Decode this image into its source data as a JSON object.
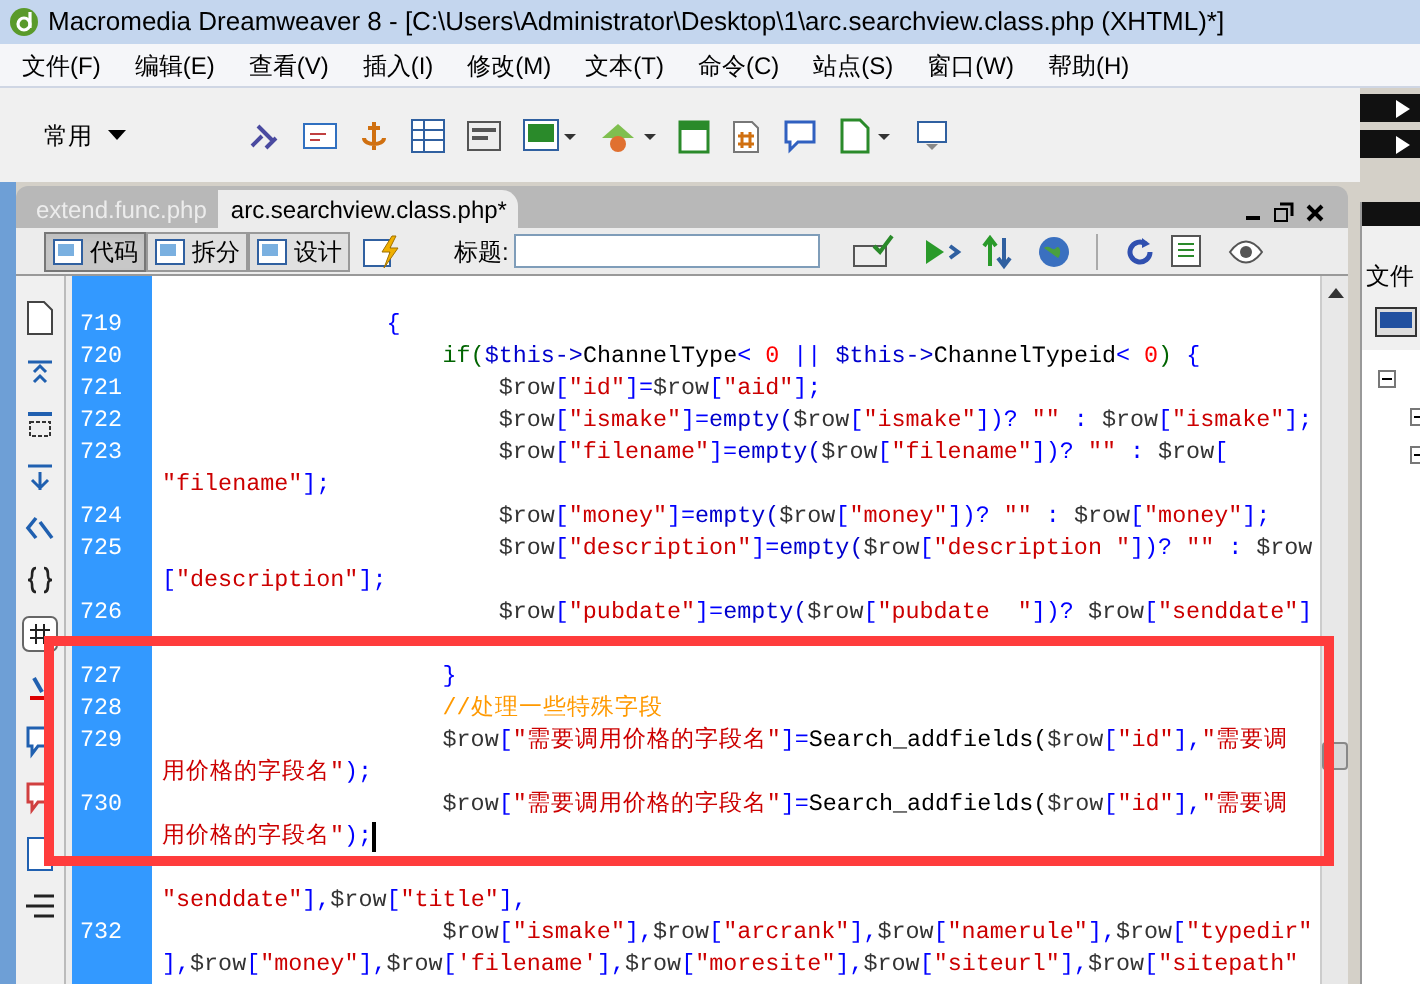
{
  "window": {
    "title": "Macromedia Dreamweaver 8 - [C:\\Users\\Administrator\\Desktop\\1\\arc.searchview.class.php (XHTML)*]"
  },
  "menu": [
    "文件(F)",
    "编辑(E)",
    "查看(V)",
    "插入(I)",
    "修改(M)",
    "文本(T)",
    "命令(C)",
    "站点(S)",
    "窗口(W)",
    "帮助(H)"
  ],
  "insert_bar": {
    "category": "常用"
  },
  "document_tabs": [
    {
      "label": "extend.func.php",
      "selected": false
    },
    {
      "label": "arc.searchview.class.php*",
      "selected": true
    }
  ],
  "view_buttons": [
    {
      "label": "代码",
      "selected": true
    },
    {
      "label": "拆分",
      "selected": false
    },
    {
      "label": "设计",
      "selected": false
    }
  ],
  "title_field": {
    "label": "标题:"
  },
  "code_lines": [
    {
      "number": "719",
      "cursor": false,
      "rows": [
        {
          "segments": [
            {
              "kind": "punct",
              "text": "                {"
            }
          ]
        }
      ]
    },
    {
      "number": "720",
      "cursor": false,
      "rows": [
        {
          "segments": [
            {
              "kind": "keyword",
              "text": "                    if("
            },
            {
              "kind": "function",
              "text": "$this->"
            },
            {
              "kind": "plain",
              "text": "ChannelType"
            },
            {
              "kind": "punct",
              "text": "< "
            },
            {
              "kind": "number",
              "text": "0"
            },
            {
              "kind": "punct",
              "text": " || "
            },
            {
              "kind": "function",
              "text": "$this->"
            },
            {
              "kind": "plain",
              "text": "ChannelTypeid"
            },
            {
              "kind": "punct",
              "text": "< "
            },
            {
              "kind": "number",
              "text": "0"
            },
            {
              "kind": "keyword",
              "text": ") "
            },
            {
              "kind": "punct",
              "text": "{"
            }
          ]
        }
      ]
    },
    {
      "number": "721",
      "cursor": false,
      "rows": [
        {
          "segments": [
            {
              "kind": "variable",
              "text": "                        $row"
            },
            {
              "kind": "punct",
              "text": "["
            },
            {
              "kind": "string",
              "text": "\"id\""
            },
            {
              "kind": "punct",
              "text": "]="
            },
            {
              "kind": "variable",
              "text": "$row"
            },
            {
              "kind": "punct",
              "text": "["
            },
            {
              "kind": "string",
              "text": "\"aid\""
            },
            {
              "kind": "punct",
              "text": "];"
            }
          ]
        }
      ]
    },
    {
      "number": "722",
      "cursor": false,
      "rows": [
        {
          "segments": [
            {
              "kind": "variable",
              "text": "                        $row"
            },
            {
              "kind": "punct",
              "text": "["
            },
            {
              "kind": "string",
              "text": "\"ismake\""
            },
            {
              "kind": "punct",
              "text": "]="
            },
            {
              "kind": "function",
              "text": "empty("
            },
            {
              "kind": "variable",
              "text": "$row"
            },
            {
              "kind": "punct",
              "text": "["
            },
            {
              "kind": "string",
              "text": "\"ismake\""
            },
            {
              "kind": "punct",
              "text": "])? "
            },
            {
              "kind": "string",
              "text": "\"\""
            },
            {
              "kind": "punct",
              "text": " : "
            },
            {
              "kind": "variable",
              "text": "$row"
            },
            {
              "kind": "punct",
              "text": "["
            },
            {
              "kind": "string",
              "text": "\"ismake\""
            },
            {
              "kind": "punct",
              "text": "];"
            }
          ]
        }
      ]
    },
    {
      "number": "723",
      "cursor": false,
      "rows": [
        {
          "segments": [
            {
              "kind": "variable",
              "text": "                        $row"
            },
            {
              "kind": "punct",
              "text": "["
            },
            {
              "kind": "string",
              "text": "\"filename\""
            },
            {
              "kind": "punct",
              "text": "]="
            },
            {
              "kind": "function",
              "text": "empty("
            },
            {
              "kind": "variable",
              "text": "$row"
            },
            {
              "kind": "punct",
              "text": "["
            },
            {
              "kind": "string",
              "text": "\"filename\""
            },
            {
              "kind": "punct",
              "text": "])? "
            },
            {
              "kind": "string",
              "text": "\"\""
            },
            {
              "kind": "punct",
              "text": " : "
            },
            {
              "kind": "variable",
              "text": "$row"
            },
            {
              "kind": "punct",
              "text": "["
            }
          ]
        },
        {
          "segments": [
            {
              "kind": "string",
              "text": "\"filename\""
            },
            {
              "kind": "punct",
              "text": "];"
            }
          ]
        }
      ]
    },
    {
      "number": "724",
      "cursor": false,
      "rows": [
        {
          "segments": [
            {
              "kind": "variable",
              "text": "                        $row"
            },
            {
              "kind": "punct",
              "text": "["
            },
            {
              "kind": "string",
              "text": "\"money\""
            },
            {
              "kind": "punct",
              "text": "]="
            },
            {
              "kind": "function",
              "text": "empty("
            },
            {
              "kind": "variable",
              "text": "$row"
            },
            {
              "kind": "punct",
              "text": "["
            },
            {
              "kind": "string",
              "text": "\"money\""
            },
            {
              "kind": "punct",
              "text": "])? "
            },
            {
              "kind": "string",
              "text": "\"\""
            },
            {
              "kind": "punct",
              "text": " : "
            },
            {
              "kind": "variable",
              "text": "$row"
            },
            {
              "kind": "punct",
              "text": "["
            },
            {
              "kind": "string",
              "text": "\"money\""
            },
            {
              "kind": "punct",
              "text": "];"
            }
          ]
        }
      ]
    },
    {
      "number": "725",
      "cursor": false,
      "rows": [
        {
          "segments": [
            {
              "kind": "variable",
              "text": "                        $row"
            },
            {
              "kind": "punct",
              "text": "["
            },
            {
              "kind": "string",
              "text": "\"description\""
            },
            {
              "kind": "punct",
              "text": "]="
            },
            {
              "kind": "function",
              "text": "empty("
            },
            {
              "kind": "variable",
              "text": "$row"
            },
            {
              "kind": "punct",
              "text": "["
            },
            {
              "kind": "string",
              "text": "\"description \""
            },
            {
              "kind": "punct",
              "text": "])? "
            },
            {
              "kind": "string",
              "text": "\"\""
            },
            {
              "kind": "punct",
              "text": " : "
            },
            {
              "kind": "variable",
              "text": "$row"
            }
          ]
        },
        {
          "segments": [
            {
              "kind": "punct",
              "text": "["
            },
            {
              "kind": "string",
              "text": "\"description\""
            },
            {
              "kind": "punct",
              "text": "];"
            }
          ]
        }
      ]
    },
    {
      "number": "726",
      "cursor": false,
      "rows": [
        {
          "segments": [
            {
              "kind": "variable",
              "text": "                        $row"
            },
            {
              "kind": "punct",
              "text": "["
            },
            {
              "kind": "string",
              "text": "\"pubdate\""
            },
            {
              "kind": "punct",
              "text": "]="
            },
            {
              "kind": "function",
              "text": "empty("
            },
            {
              "kind": "variable",
              "text": "$row"
            },
            {
              "kind": "punct",
              "text": "["
            },
            {
              "kind": "string",
              "text": "\"pubdate  \""
            },
            {
              "kind": "punct",
              "text": "])? "
            },
            {
              "kind": "variable",
              "text": "$row"
            },
            {
              "kind": "punct",
              "text": "["
            },
            {
              "kind": "string",
              "text": "\"senddate\""
            },
            {
              "kind": "punct",
              "text": "]"
            }
          ]
        },
        {
          "covered": true
        }
      ]
    },
    {
      "number": "727",
      "cursor": false,
      "rows": [
        {
          "segments": [
            {
              "kind": "punct",
              "text": "                    }"
            }
          ]
        }
      ]
    },
    {
      "number": "728",
      "cursor": false,
      "rows": [
        {
          "segments": [
            {
              "kind": "comment",
              "text": "                    //处理一些特殊字段"
            }
          ]
        }
      ]
    },
    {
      "number": "729",
      "cursor": false,
      "rows": [
        {
          "segments": [
            {
              "kind": "variable",
              "text": "                    $row"
            },
            {
              "kind": "punct",
              "text": "["
            },
            {
              "kind": "string",
              "text": "\"需要调用价格的字段名\""
            },
            {
              "kind": "punct",
              "text": "]="
            },
            {
              "kind": "plain",
              "text": "Search_addfields("
            },
            {
              "kind": "variable",
              "text": "$row"
            },
            {
              "kind": "punct",
              "text": "["
            },
            {
              "kind": "string",
              "text": "\"id\""
            },
            {
              "kind": "punct",
              "text": "],"
            },
            {
              "kind": "string",
              "text": "\"需要调"
            }
          ]
        },
        {
          "segments": [
            {
              "kind": "string",
              "text": "用价格的字段名\""
            },
            {
              "kind": "punct",
              "text": ");"
            }
          ]
        }
      ]
    },
    {
      "number": "730",
      "cursor": true,
      "rows": [
        {
          "segments": [
            {
              "kind": "variable",
              "text": "                    $row"
            },
            {
              "kind": "punct",
              "text": "["
            },
            {
              "kind": "string",
              "text": "\"需要调用价格的字段名\""
            },
            {
              "kind": "punct",
              "text": "]="
            },
            {
              "kind": "plain",
              "text": "Search_addfields("
            },
            {
              "kind": "variable",
              "text": "$row"
            },
            {
              "kind": "punct",
              "text": "["
            },
            {
              "kind": "string",
              "text": "\"id\""
            },
            {
              "kind": "punct",
              "text": "],"
            },
            {
              "kind": "string",
              "text": "\"需要调"
            }
          ]
        },
        {
          "segments": [
            {
              "kind": "string",
              "text": "用价格的字段名\""
            },
            {
              "kind": "punct",
              "text": ");"
            }
          ]
        }
      ]
    },
    {
      "cursor": false,
      "rows": [
        {
          "covered": true
        },
        {
          "segments": [
            {
              "kind": "string",
              "text": "\"senddate\""
            },
            {
              "kind": "punct",
              "text": "],"
            },
            {
              "kind": "variable",
              "text": "$row"
            },
            {
              "kind": "punct",
              "text": "["
            },
            {
              "kind": "string",
              "text": "\"title\""
            },
            {
              "kind": "punct",
              "text": "],"
            }
          ]
        }
      ]
    },
    {
      "number": "732",
      "cursor": false,
      "rows": [
        {
          "segments": [
            {
              "kind": "variable",
              "text": "                    $row"
            },
            {
              "kind": "punct",
              "text": "["
            },
            {
              "kind": "string",
              "text": "\"ismake\""
            },
            {
              "kind": "punct",
              "text": "],"
            },
            {
              "kind": "variable",
              "text": "$row"
            },
            {
              "kind": "punct",
              "text": "["
            },
            {
              "kind": "string",
              "text": "\"arcrank\""
            },
            {
              "kind": "punct",
              "text": "],"
            },
            {
              "kind": "variable",
              "text": "$row"
            },
            {
              "kind": "punct",
              "text": "["
            },
            {
              "kind": "string",
              "text": "\"namerule\""
            },
            {
              "kind": "punct",
              "text": "],"
            },
            {
              "kind": "variable",
              "text": "$row"
            },
            {
              "kind": "punct",
              "text": "["
            },
            {
              "kind": "string",
              "text": "\"typedir\""
            }
          ]
        },
        {
          "segments": [
            {
              "kind": "punct",
              "text": "],"
            },
            {
              "kind": "variable",
              "text": "$row"
            },
            {
              "kind": "punct",
              "text": "["
            },
            {
              "kind": "string",
              "text": "\"money\""
            },
            {
              "kind": "punct",
              "text": "],"
            },
            {
              "kind": "variable",
              "text": "$row"
            },
            {
              "kind": "punct",
              "text": "["
            },
            {
              "kind": "string",
              "text": "'filename'"
            },
            {
              "kind": "punct",
              "text": "],"
            },
            {
              "kind": "variable",
              "text": "$row"
            },
            {
              "kind": "punct",
              "text": "["
            },
            {
              "kind": "string",
              "text": "\"moresite\""
            },
            {
              "kind": "punct",
              "text": "],"
            },
            {
              "kind": "variable",
              "text": "$row"
            },
            {
              "kind": "punct",
              "text": "["
            },
            {
              "kind": "string",
              "text": "\"siteurl\""
            },
            {
              "kind": "punct",
              "text": "],"
            },
            {
              "kind": "variable",
              "text": "$row"
            },
            {
              "kind": "punct",
              "text": "["
            },
            {
              "kind": "string",
              "text": "\"sitepath\""
            }
          ]
        }
      ]
    }
  ],
  "files_panel": {
    "title": "文件"
  }
}
